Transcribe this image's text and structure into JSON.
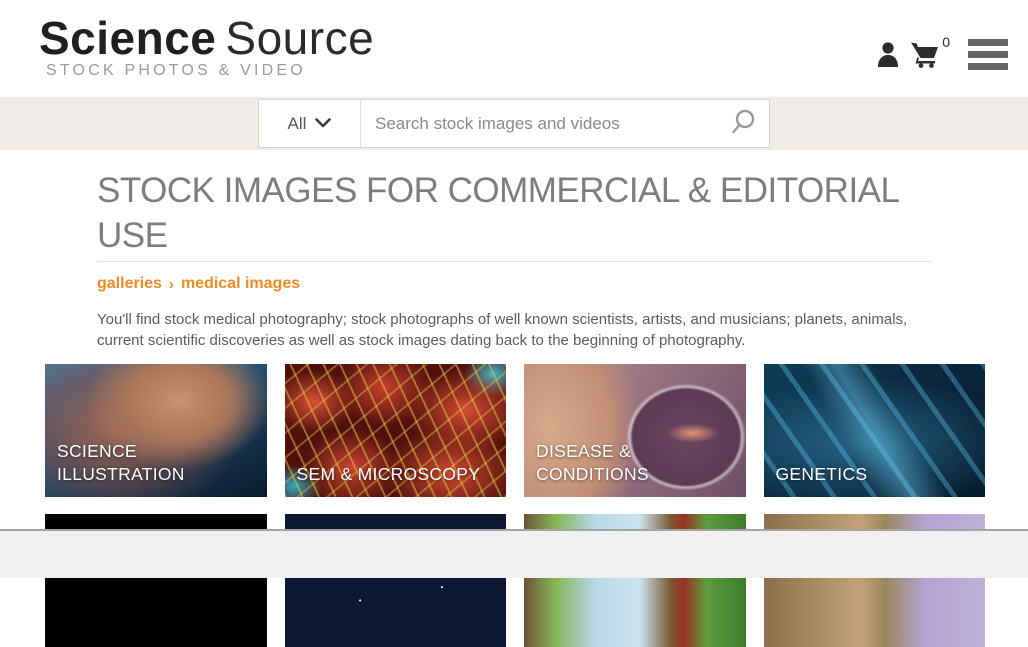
{
  "header": {
    "logo": {
      "word_bold": "Science",
      "word_light": "Source",
      "tagline": "STOCK PHOTOS & VIDEO"
    },
    "cart_count": "0",
    "icons": {
      "account": "person-icon",
      "cart": "shopping-cart-icon",
      "menu": "hamburger-menu-icon"
    }
  },
  "search": {
    "category_selected": "All",
    "placeholder": "Search stock images and videos",
    "icons": {
      "dropdown": "chevron-down-icon",
      "submit": "magnifier-icon"
    }
  },
  "page": {
    "title": "STOCK IMAGES FOR COMMERCIAL & EDITORIAL USE",
    "breadcrumb": [
      "galleries",
      "medical images"
    ],
    "breadcrumb_separator": "›",
    "description": "You'll find stock medical photography; stock photographs of well known scientists, artists, and musicians; planets, animals, current scientific discoveries as well as stock images dating back to the beginning of photography."
  },
  "galleries": {
    "tiles": [
      {
        "label": "SCIENCE ILLUSTRATION",
        "bg": "science-illustration"
      },
      {
        "label": "SEM & MICROSCOPY",
        "bg": "sem-microscopy"
      },
      {
        "label": "DISEASE & CONDITIONS",
        "bg": "disease-conditions"
      },
      {
        "label": "GENETICS",
        "bg": "genetics"
      },
      {
        "label": "",
        "bg": "row2-dark"
      },
      {
        "label": "",
        "bg": "row2-astronomy"
      },
      {
        "label": "",
        "bg": "row2-nature"
      },
      {
        "label": "",
        "bg": "row2-animals"
      }
    ]
  },
  "colors": {
    "accent_orange": "#ee8a23",
    "title_gray": "#7d7d7d",
    "icon_dark": "#2d2d2d",
    "menu_gray": "#666666",
    "search_band": "#f0ede9"
  }
}
